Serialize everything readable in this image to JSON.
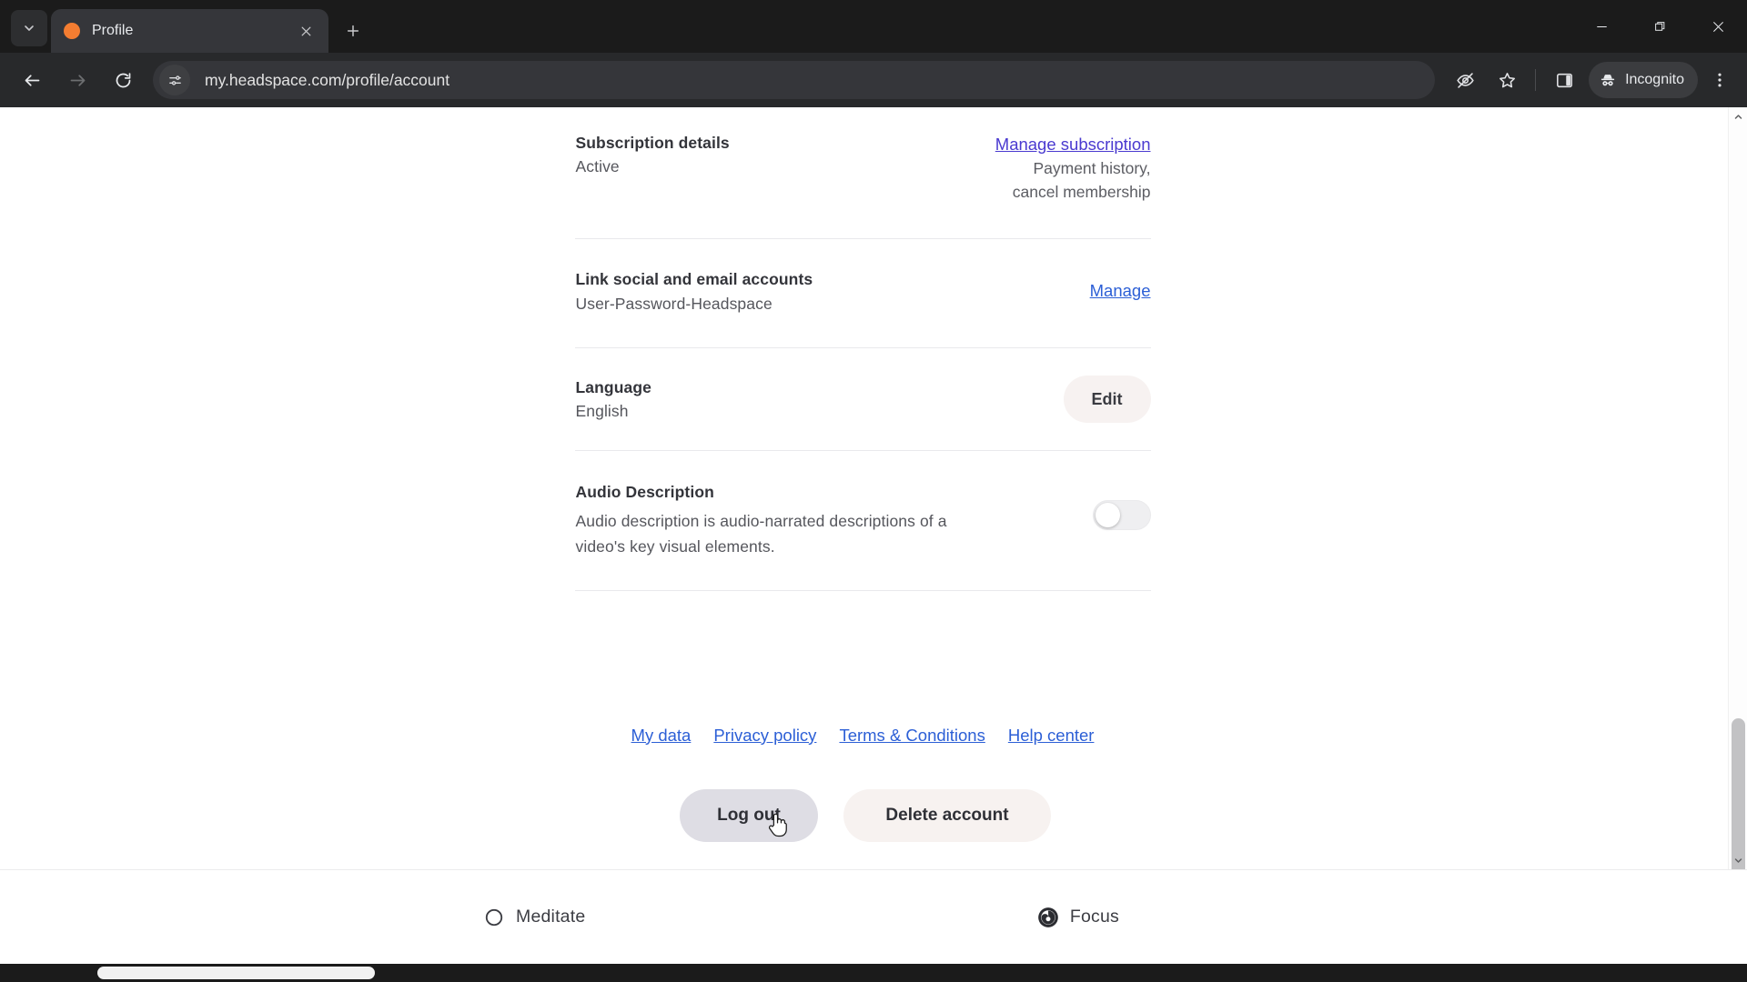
{
  "browser": {
    "tab": {
      "title": "Profile",
      "favicon_color": "#f47d31"
    },
    "new_tab_label": "+",
    "url": "my.headspace.com/profile/account",
    "incognito_label": "Incognito",
    "window_controls": {
      "minimize": "minimize-icon",
      "restore": "restore-icon",
      "close": "close-icon"
    },
    "nav_icons": [
      "back-icon",
      "forward-icon",
      "reload-icon"
    ],
    "toolbar_icons": [
      "eye-off-icon",
      "bookmark-star-icon",
      "side-panel-icon",
      "incognito-icon",
      "more-menu-icon"
    ]
  },
  "page": {
    "sections": [
      {
        "id": "subscription",
        "title": "Subscription details",
        "subtitle": "Active",
        "action_kind": "link-visited",
        "action_label": "Manage subscription",
        "note_line1": "Payment history,",
        "note_line2": "cancel membership"
      },
      {
        "id": "linked-accounts",
        "title": "Link social and email accounts",
        "subtitle": "User-Password-Headspace",
        "action_kind": "link-blue",
        "action_label": "Manage"
      },
      {
        "id": "language",
        "title": "Language",
        "subtitle": "English",
        "action_kind": "button",
        "action_label": "Edit"
      },
      {
        "id": "audio-description",
        "title": "Audio Description",
        "desc_line1": "Audio description is audio-narrated descriptions of a",
        "desc_line2": "video's key visual elements.",
        "action_kind": "toggle",
        "toggle_state": "off"
      }
    ],
    "footer_links": [
      {
        "label": "My data"
      },
      {
        "label": "Privacy policy"
      },
      {
        "label": "Terms & Conditions"
      },
      {
        "label": "Help center"
      }
    ],
    "actions": {
      "logout_label": "Log out",
      "delete_label": "Delete account"
    },
    "bottom_nav": [
      {
        "label": "Meditate",
        "icon": "circle-outline-icon"
      },
      {
        "label": "Focus",
        "icon": "focus-spiral-icon"
      }
    ]
  },
  "colors": {
    "link_blue": "#2c5fd6",
    "link_visited": "#4a3ad0",
    "favicon_orange": "#f47d31",
    "logout_bg": "#dedde4",
    "delete_bg": "#f7f2f0",
    "edit_bg": "#f7f2f1"
  }
}
